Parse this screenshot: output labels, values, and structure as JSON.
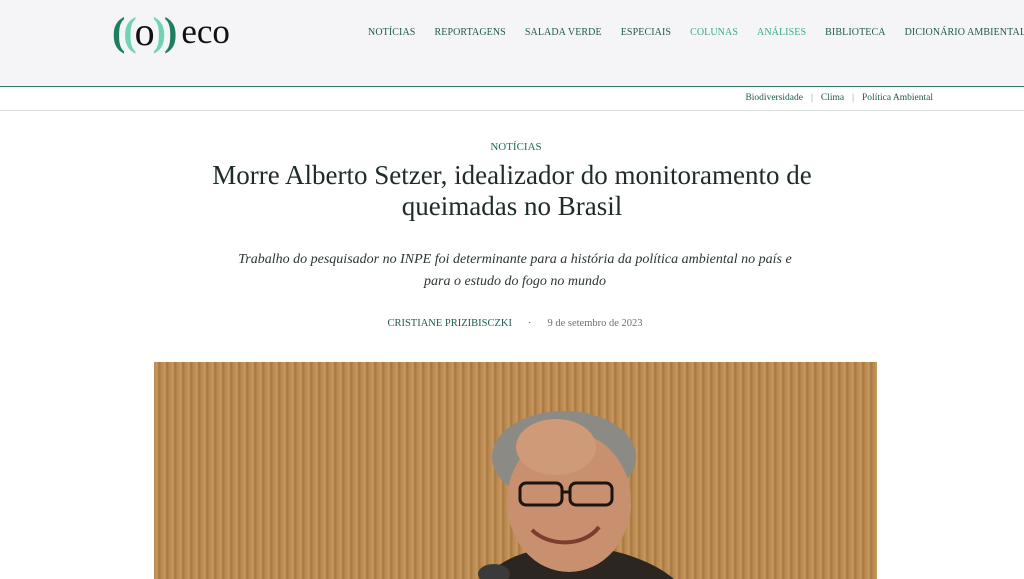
{
  "site": {
    "logo_mark": "((o))",
    "logo_word": "eco"
  },
  "nav": {
    "items": [
      {
        "label": "NOTÍCIAS"
      },
      {
        "label": "REPORTAGENS"
      },
      {
        "label": "SALADA VERDE"
      },
      {
        "label": "ESPECIAIS"
      },
      {
        "label": "COLUNAS"
      },
      {
        "label": "ANÁLISES"
      },
      {
        "label": "BIBLIOTECA"
      },
      {
        "label": "DICIONÁRIO AMBIENTAL"
      }
    ]
  },
  "subnav": {
    "items": [
      {
        "label": "Biodiversidade"
      },
      {
        "label": "Clima"
      },
      {
        "label": "Política Ambiental"
      }
    ]
  },
  "article": {
    "category": "NOTÍCIAS",
    "title": "Morre Alberto Setzer, idealizador do monitoramento de queimadas no Brasil",
    "lead": "Trabalho do pesquisador no INPE foi determinante para a história da política ambiental no país e para o estudo do fogo no mundo",
    "author": "CRISTIANE PRIZIBISCZKI",
    "separator": "·",
    "date": "9 de setembro de 2023"
  },
  "colors": {
    "brand_green": "#1d7f60",
    "nav_text": "#1d5a4f",
    "nav_highlight": "#3aa98d"
  }
}
